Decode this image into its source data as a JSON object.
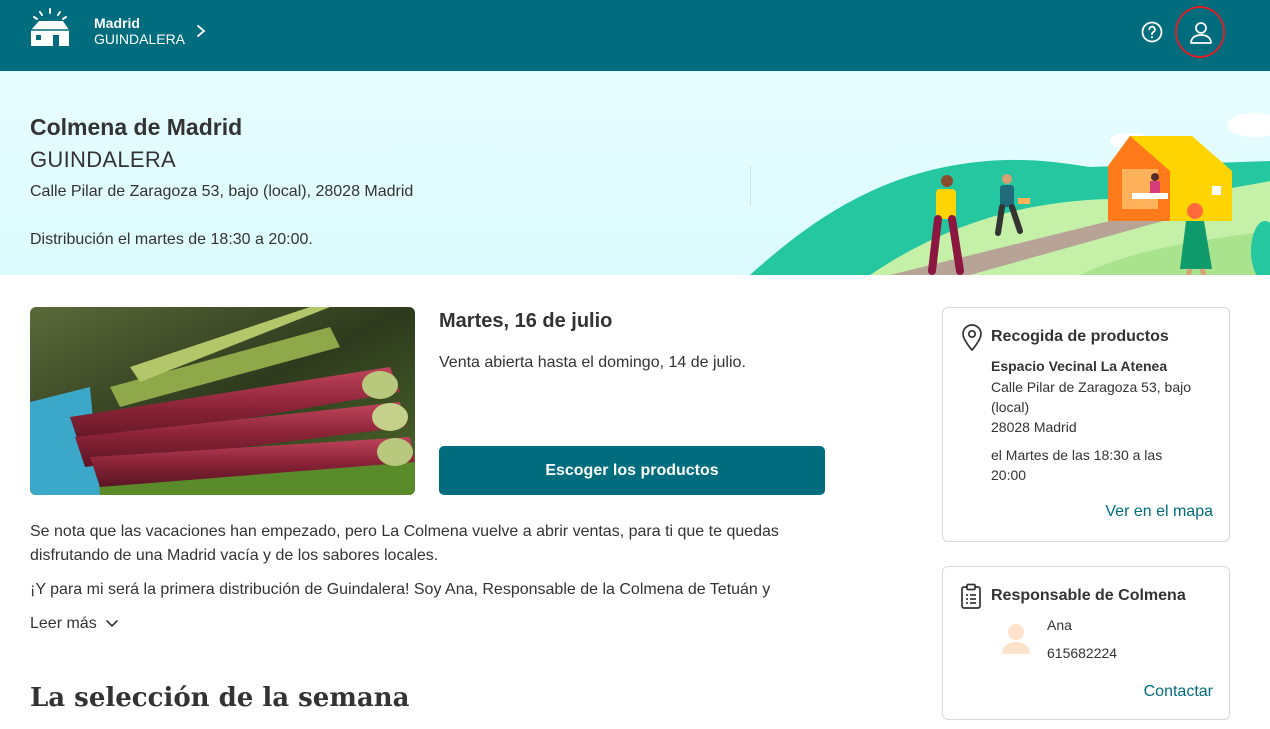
{
  "header": {
    "city": "Madrid",
    "hive": "GUINDALERA",
    "icons": [
      "hive-house-logo",
      "chevron-right-icon",
      "help-icon",
      "user-icon"
    ]
  },
  "hero": {
    "title": "Colmena de Madrid",
    "subtitle": "GUINDALERA",
    "address": "Calle Pilar de Zaragoza 53, bajo (local), 28028 Madrid",
    "distribution": "Distribución el martes de 18:30 a 20:00."
  },
  "sale": {
    "date": "Martes, 16 de julio",
    "status": "Venta abierta hasta el domingo, 14 de julio.",
    "cta_label": "Escoger los productos"
  },
  "description": {
    "paragraph1": "Se nota que las vacaciones han empezado, pero La Colmena vuelve a abrir ventas, para ti que te quedas disfrutando de una Madrid vacía y de los sabores locales.",
    "paragraph2": "¡Y para mi será la primera distribución de Guindalera! Soy Ana, Responsable de la Colmena de Tetuán y",
    "read_more": "Leer más"
  },
  "week": {
    "title": "La selección de la semana"
  },
  "pickup": {
    "title": "Recogida de productos",
    "place": "Espacio Vecinal La Atenea",
    "address": "Calle Pilar de Zaragoza 53, bajo (local)",
    "city": "28028 Madrid",
    "schedule": "el Martes de las 18:30 a las 20:00",
    "map_link": "Ver en el mapa"
  },
  "manager": {
    "title": "Responsable de Colmena",
    "name": "Ana",
    "phone": "615682224",
    "contact_link": "Contactar"
  },
  "colors": {
    "brand": "#006d7f",
    "highlight_ring": "#d7202a",
    "hero_bg": "#dcfbfe"
  }
}
